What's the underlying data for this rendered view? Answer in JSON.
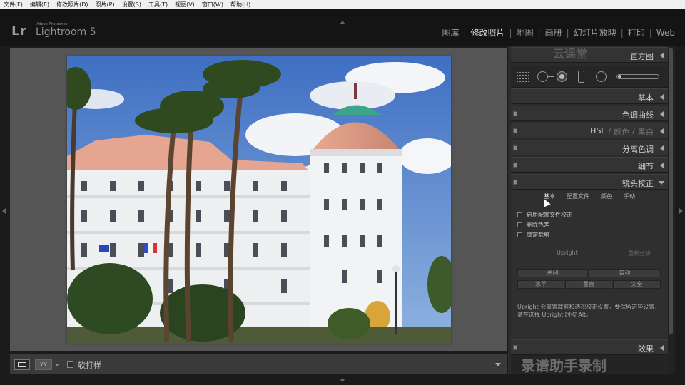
{
  "menu": [
    "文件(F)",
    "编辑(E)",
    "修改照片(D)",
    "照片(P)",
    "设置(S)",
    "工具(T)",
    "视图(V)",
    "窗口(W)",
    "帮助(H)"
  ],
  "app": {
    "logo": "Lr",
    "sub": "Adobe Photoshop",
    "name": "Lightroom 5"
  },
  "modules": [
    "图库",
    "修改照片",
    "地图",
    "画册",
    "幻灯片放映",
    "打印",
    "Web"
  ],
  "active_module": "修改照片",
  "toolbar": {
    "yy_label": "YY",
    "softproof_label": "软打样"
  },
  "panels": {
    "histogram": "直方图",
    "basic": "基本",
    "tone_curve": "色调曲线",
    "hsl": "HSL",
    "color": "颜色",
    "bw": "黑白",
    "split_toning": "分离色调",
    "detail": "细节",
    "lens_corrections": "镜头校正",
    "effects": "效果"
  },
  "lens": {
    "tabs": [
      "基本",
      "配置文件",
      "颜色",
      "手动"
    ],
    "active_tab": "基本",
    "checkboxes": [
      "启用配置文件校正",
      "删除色差",
      "锁定裁剪"
    ],
    "upright_label": "Upright",
    "reanalyze_label": "重新分析",
    "buttons_row1": [
      "关闭",
      "自动"
    ],
    "buttons_row2": [
      "水平",
      "垂直",
      "完全"
    ],
    "note": "Upright 会重置裁剪和透视校正设置。要保留这些设置，请在选择 Upright 时按 Alt。"
  },
  "watermark_top": "云课堂",
  "watermark_bottom": "录谱助手录制",
  "colors": {
    "accent_text": "#e0e0e0",
    "panel_bg": "#2b2b2b",
    "canvas_bg": "#555555"
  }
}
